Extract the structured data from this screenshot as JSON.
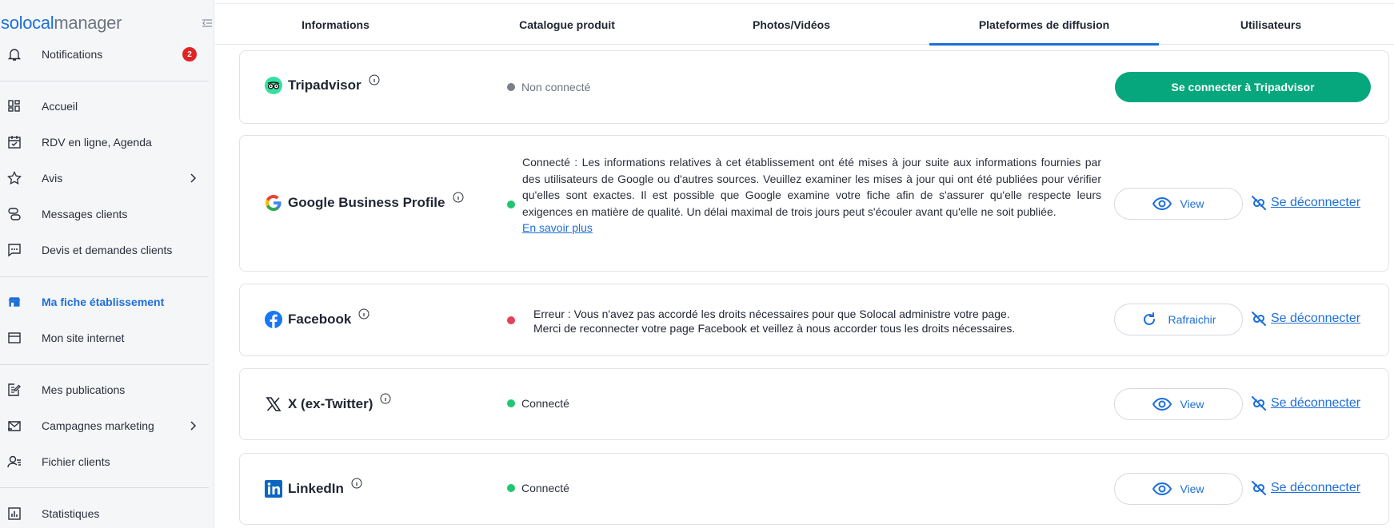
{
  "sidebar": {
    "logo": {
      "part1": "solocal",
      "part2": "manager"
    },
    "items": {
      "notifications": {
        "label": "Notifications",
        "badge": "2"
      },
      "home": {
        "label": "Accueil"
      },
      "agenda": {
        "label": "RDV en ligne, Agenda"
      },
      "reviews": {
        "label": "Avis"
      },
      "messages": {
        "label": "Messages clients"
      },
      "quotes": {
        "label": "Devis et demandes clients"
      },
      "listing": {
        "label": "Ma fiche établissement"
      },
      "website": {
        "label": "Mon site internet"
      },
      "publications": {
        "label": "Mes publications"
      },
      "campaigns": {
        "label": "Campagnes marketing"
      },
      "customers": {
        "label": "Fichier clients"
      },
      "stats": {
        "label": "Statistiques"
      }
    }
  },
  "tabs": {
    "info": "Informations",
    "catalog": "Catalogue produit",
    "media": "Photos/Vidéos",
    "platforms": "Plateformes de diffusion",
    "users": "Utilisateurs"
  },
  "platforms": {
    "tripadvisor": {
      "name": "Tripadvisor",
      "status": "Non connecté",
      "connect_label": "Se connecter à Tripadvisor"
    },
    "google": {
      "name": "Google Business Profile",
      "status_text": "Connecté : Les informations relatives à cet établissement ont été mises à jour suite aux informations fournies par des utilisateurs de Google ou d'autres sources. Veuillez examiner les mises à jour qui ont été publiées pour vérifier qu'elles sont exactes. Il est possible que Google examine votre fiche afin de s'assurer qu'elle respecte leurs exigences en matière de qualité. Un délai maximal de trois jours peut s'écouler avant qu'elle ne soit publiée.",
      "link": "En savoir plus",
      "view_label": "View",
      "disconnect_label": "Se déconnecter"
    },
    "facebook": {
      "name": "Facebook",
      "error_line1": "Erreur : Vous n'avez pas accordé les droits nécessaires pour que Solocal administre votre page.",
      "error_line2": "Merci de reconnecter votre page Facebook et veillez à nous accorder tous les droits nécessaires.",
      "refresh_label": "Rafraichir",
      "disconnect_label": "Se déconnecter"
    },
    "x": {
      "name": "X (ex-Twitter)",
      "status": "Connecté",
      "view_label": "View",
      "disconnect_label": "Se déconnecter"
    },
    "linkedin": {
      "name": "LinkedIn",
      "status": "Connecté",
      "view_label": "View",
      "disconnect_label": "Se déconnecter"
    }
  },
  "colors": {
    "accent": "#1e6fd9",
    "primary_button": "#06a77d",
    "connected": "#1fc773",
    "error": "#e4405a",
    "badge": "#e02424"
  }
}
